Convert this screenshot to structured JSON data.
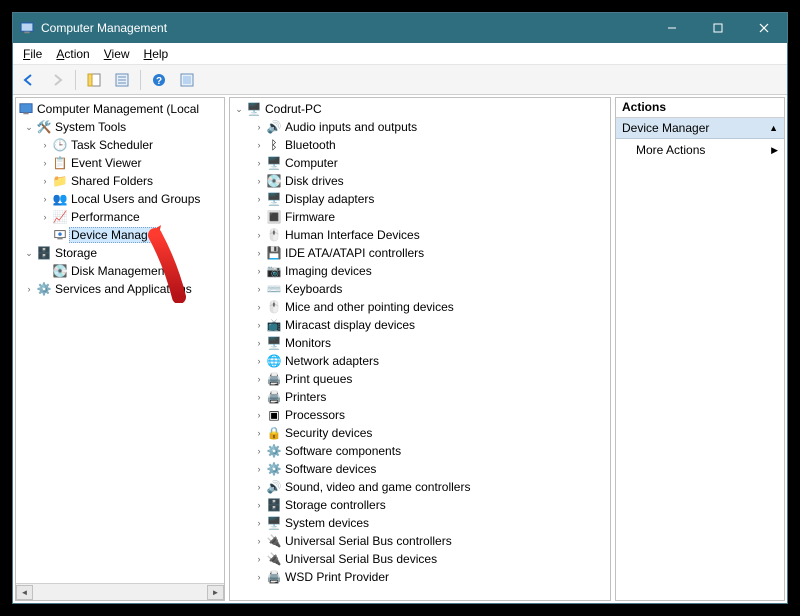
{
  "window": {
    "title": "Computer Management"
  },
  "menubar": {
    "file": "File",
    "action": "Action",
    "view": "View",
    "help": "Help"
  },
  "left_tree": {
    "root": "Computer Management (Local",
    "system_tools": "System Tools",
    "task_scheduler": "Task Scheduler",
    "event_viewer": "Event Viewer",
    "shared_folders": "Shared Folders",
    "local_users": "Local Users and Groups",
    "performance": "Performance",
    "device_manager": "Device Manager",
    "storage": "Storage",
    "disk_management": "Disk Management",
    "services_apps": "Services and Applications"
  },
  "center_tree": {
    "root": "Codrut-PC",
    "items": [
      "Audio inputs and outputs",
      "Bluetooth",
      "Computer",
      "Disk drives",
      "Display adapters",
      "Firmware",
      "Human Interface Devices",
      "IDE ATA/ATAPI controllers",
      "Imaging devices",
      "Keyboards",
      "Mice and other pointing devices",
      "Miracast display devices",
      "Monitors",
      "Network adapters",
      "Print queues",
      "Printers",
      "Processors",
      "Security devices",
      "Software components",
      "Software devices",
      "Sound, video and game controllers",
      "Storage controllers",
      "System devices",
      "Universal Serial Bus controllers",
      "Universal Serial Bus devices",
      "WSD Print Provider"
    ]
  },
  "actions": {
    "header": "Actions",
    "section": "Device Manager",
    "more": "More Actions"
  }
}
